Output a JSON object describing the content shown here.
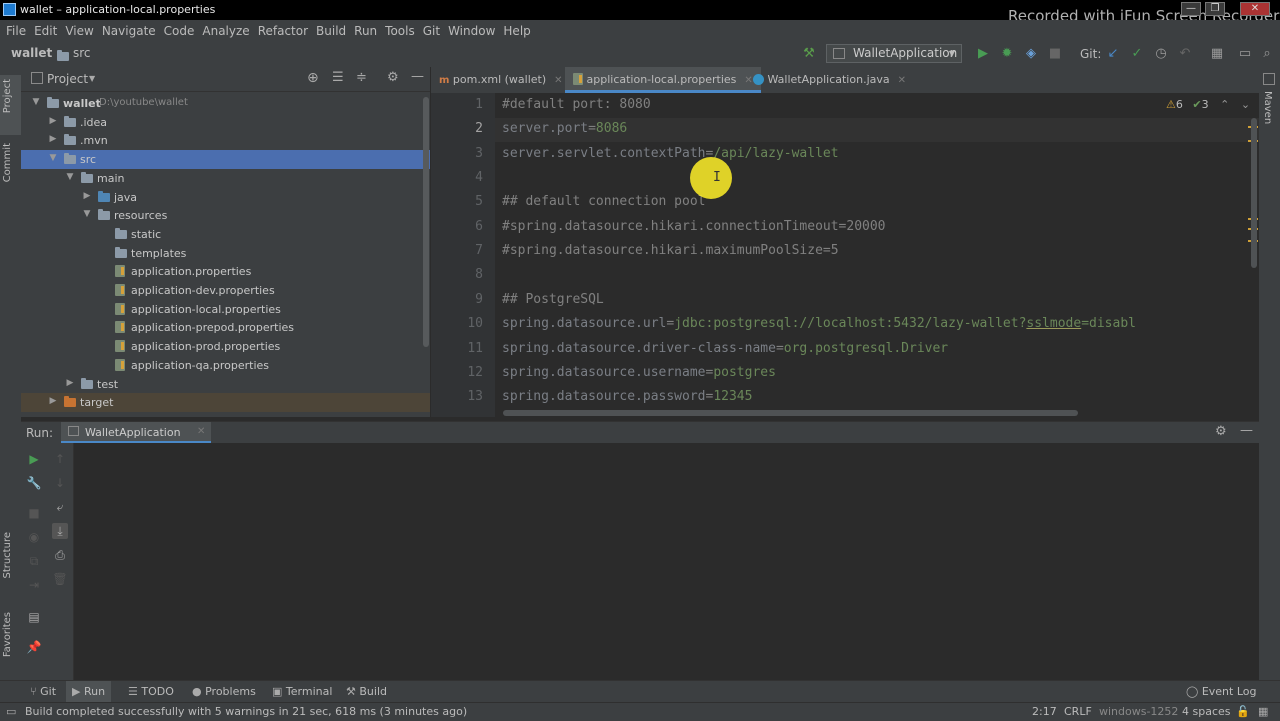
{
  "window": {
    "title": "wallet – application-local.properties",
    "watermark": "Recorded with iFun Screen Recorder"
  },
  "menu": [
    "File",
    "Edit",
    "View",
    "Navigate",
    "Code",
    "Analyze",
    "Refactor",
    "Build",
    "Run",
    "Tools",
    "Git",
    "Window",
    "Help"
  ],
  "breadcrumb": {
    "project": "wallet",
    "folder": "src"
  },
  "toolbar": {
    "run_config": "WalletApplication",
    "git_label": "Git:"
  },
  "left_strip": {
    "project_tab": "Project",
    "commit_tab": "Commit",
    "structure_tab": "Structure",
    "favorites_tab": "Favorites"
  },
  "right_strip": {
    "maven_tab": "Maven"
  },
  "project_panel": {
    "title": "Project",
    "tree": [
      {
        "label": "wallet",
        "path": "D:\\youtube\\wallet",
        "type": "module",
        "arrow": "▼"
      },
      {
        "label": ".idea",
        "type": "folder",
        "arrow": "▶"
      },
      {
        "label": ".mvn",
        "type": "folder",
        "arrow": "▶"
      },
      {
        "label": "src",
        "type": "folder",
        "arrow": "▼",
        "selected": true
      },
      {
        "label": "main",
        "type": "folder",
        "arrow": "▼"
      },
      {
        "label": "java",
        "type": "source-folder",
        "arrow": "▶"
      },
      {
        "label": "resources",
        "type": "resource-folder",
        "arrow": "▼"
      },
      {
        "label": "static",
        "type": "folder",
        "arrow": ""
      },
      {
        "label": "templates",
        "type": "folder",
        "arrow": ""
      },
      {
        "label": "application.properties",
        "type": "properties",
        "arrow": ""
      },
      {
        "label": "application-dev.properties",
        "type": "properties",
        "arrow": ""
      },
      {
        "label": "application-local.properties",
        "type": "properties",
        "arrow": ""
      },
      {
        "label": "application-prepod.properties",
        "type": "properties",
        "arrow": ""
      },
      {
        "label": "application-prod.properties",
        "type": "properties",
        "arrow": ""
      },
      {
        "label": "application-qa.properties",
        "type": "properties",
        "arrow": ""
      },
      {
        "label": "test",
        "type": "folder",
        "arrow": "▶"
      },
      {
        "label": "target",
        "type": "excluded-folder",
        "arrow": "▶"
      }
    ]
  },
  "editor": {
    "tabs": [
      {
        "label": "pom.xml (wallet)",
        "active": false
      },
      {
        "label": "application-local.properties",
        "active": true
      },
      {
        "label": "WalletApplication.java",
        "active": false
      }
    ],
    "warnings": "6",
    "weak_warnings": "3",
    "current_line": 2,
    "lines": [
      {
        "n": "1",
        "parts": [
          {
            "t": "#default port: 8080",
            "c": "comment"
          }
        ]
      },
      {
        "n": "2",
        "parts": [
          {
            "t": "server.port",
            "c": "key"
          },
          {
            "t": "=",
            "c": "eq"
          },
          {
            "t": "8086",
            "c": "val"
          }
        ]
      },
      {
        "n": "3",
        "parts": [
          {
            "t": "server.servlet.contextPath",
            "c": "key"
          },
          {
            "t": "=",
            "c": "eq"
          },
          {
            "t": "/api/lazy-wallet",
            "c": "val"
          }
        ]
      },
      {
        "n": "4",
        "parts": []
      },
      {
        "n": "5",
        "parts": [
          {
            "t": "## default connection pool",
            "c": "comment"
          }
        ]
      },
      {
        "n": "6",
        "parts": [
          {
            "t": "#spring.datasource.hikari.connectionTimeout=20000",
            "c": "comment"
          }
        ]
      },
      {
        "n": "7",
        "parts": [
          {
            "t": "#spring.datasource.hikari.maximumPoolSize=5",
            "c": "comment"
          }
        ]
      },
      {
        "n": "8",
        "parts": []
      },
      {
        "n": "9",
        "parts": [
          {
            "t": "## PostgreSQL",
            "c": "comment"
          }
        ]
      },
      {
        "n": "10",
        "parts": [
          {
            "t": "spring.datasource.url",
            "c": "key"
          },
          {
            "t": "=",
            "c": "eq"
          },
          {
            "t": "jdbc:postgresql://localhost:5432/lazy-wallet?",
            "c": "val"
          },
          {
            "t": "sslmode",
            "c": "val"
          },
          {
            "t": "=disabl",
            "c": "val"
          }
        ]
      },
      {
        "n": "11",
        "parts": [
          {
            "t": "spring.datasource.driver-class-name",
            "c": "key"
          },
          {
            "t": "=",
            "c": "eq"
          },
          {
            "t": "org.postgresql.Driver",
            "c": "val"
          }
        ]
      },
      {
        "n": "12",
        "parts": [
          {
            "t": "spring.datasource.username",
            "c": "key"
          },
          {
            "t": "=",
            "c": "eq"
          },
          {
            "t": "postgres",
            "c": "val"
          }
        ]
      },
      {
        "n": "13",
        "parts": [
          {
            "t": "spring.datasource.password",
            "c": "key"
          },
          {
            "t": "=",
            "c": "eq"
          },
          {
            "t": "12345",
            "c": "val"
          }
        ]
      }
    ]
  },
  "run_panel": {
    "label": "Run:",
    "tab": "WalletApplication"
  },
  "bottom_tools": [
    "Git",
    "Run",
    "TODO",
    "Problems",
    "Terminal",
    "Build",
    "Event Log"
  ],
  "status": {
    "message": "Build completed successfully with 5 warnings in 21 sec, 618 ms (3 minutes ago)",
    "position": "2:17",
    "line_sep": "CRLF",
    "encoding": "windows-1252",
    "indent": "4 spaces"
  },
  "colors": {
    "accent": "#4a88c7",
    "selection": "#4b6eaf",
    "run_green": "#499c54",
    "warning": "#d0a037"
  }
}
